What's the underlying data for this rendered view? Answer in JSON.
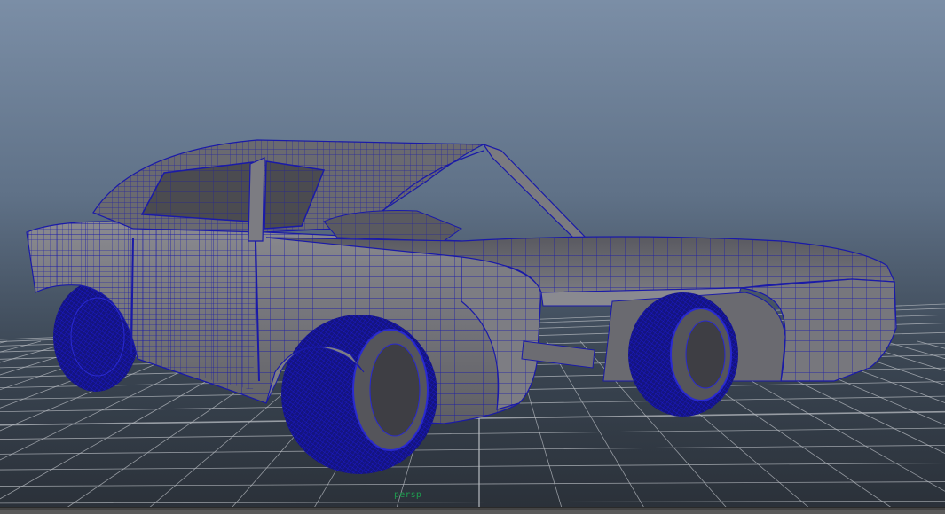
{
  "viewport": {
    "camera_label": "persp",
    "mode": "wireframe-on-shaded",
    "colors": {
      "background_top": "#7b8ea6",
      "background_bottom": "#2a3038",
      "grid": "#b8bcc2",
      "mesh_shaded": "#6e6e72",
      "mesh_wire": "#1a1aa8",
      "wheel_wire": "#1616b0"
    }
  },
  "scene": {
    "object": "car-model",
    "icons": [
      "grid-plane",
      "car-mesh",
      "wheel-mesh"
    ]
  }
}
